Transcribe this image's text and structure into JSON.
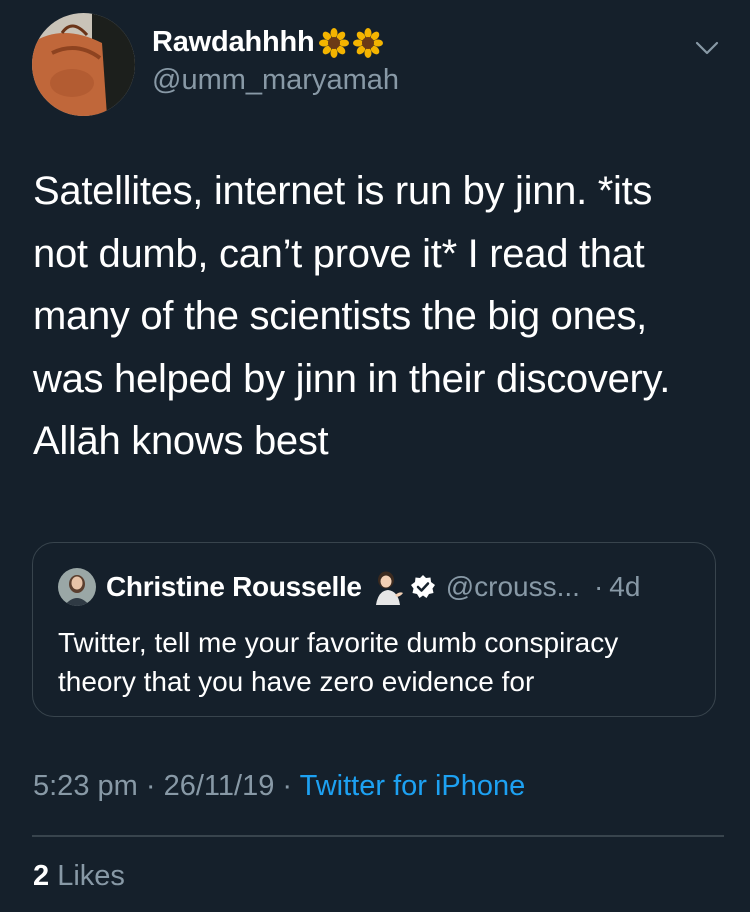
{
  "tweet": {
    "display_name": "Rawdahhhh",
    "name_emojis": [
      "sunflower-emoji",
      "sunflower-emoji"
    ],
    "handle": "@umm_maryamah",
    "menu_icon": "chevron-down-icon",
    "text": "Satellites, internet is run by jinn.  *its\nnot dumb, can’t prove it* I read that\nmany of the scientists the big ones,\nwas helped by jinn in their discovery.\nAllāh knows best"
  },
  "quoted_tweet": {
    "display_name": "Christine Rousselle",
    "name_emoji": "woman-tipping-hand-emoji",
    "verified_icon": "verified-badge-icon",
    "handle": "@crouss...",
    "separator": "·",
    "time": "4d",
    "text": "Twitter, tell me your favorite dumb conspiracy\ntheory that you have zero evidence for"
  },
  "meta": {
    "time": "5:23 pm",
    "separator": "·",
    "date": "26/11/19",
    "source": "Twitter for iPhone"
  },
  "engagement": {
    "likes_count": "2",
    "likes_label": "Likes"
  },
  "colors": {
    "background": "#15202b",
    "primary_text": "#ffffff",
    "secondary_text": "#8899a6",
    "accent": "#1da1f2",
    "border": "#38444d"
  }
}
